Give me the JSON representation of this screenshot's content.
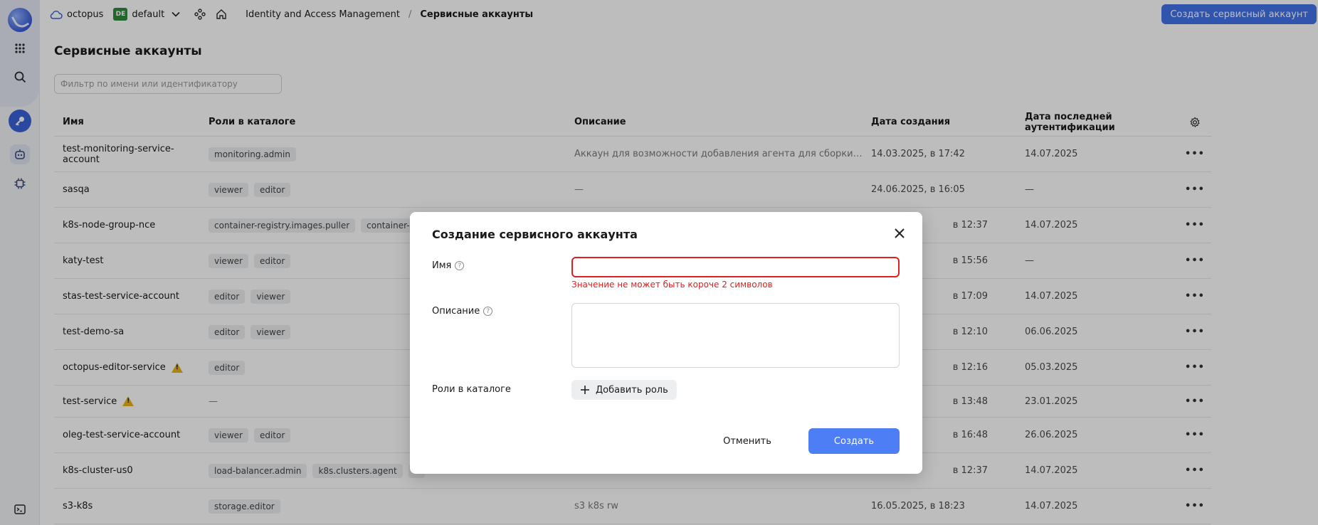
{
  "topbar": {
    "cloud_name": "octopus",
    "folder_badge": "DE",
    "folder_name": "default",
    "service": "Identity and Access Management",
    "separator": "/",
    "current": "Сервисные аккаунты",
    "create_button": "Создать сервисный аккаунт"
  },
  "page": {
    "title": "Сервисные аккаунты",
    "filter_placeholder": "Фильтр по имени или идентификатору"
  },
  "table": {
    "headers": [
      "Имя",
      "Роли в каталоге",
      "Описание",
      "Дата создания",
      "Дата последней аутентификации"
    ],
    "rows": [
      {
        "name": "test-monitoring-service-account",
        "roles": [
          "monitoring.admin"
        ],
        "description": "Аккаун для возможности добавления агента для сборки метрик...",
        "created": "14.03.2025, в 17:42",
        "last_auth": "14.07.2025"
      },
      {
        "name": "sasqa",
        "roles": [
          "viewer",
          "editor"
        ],
        "description": "—",
        "created": "24.06.2025, в 16:05",
        "last_auth": "—"
      },
      {
        "name": "k8s-node-group-nce",
        "roles": [
          "container-registry.images.puller",
          "container-re"
        ],
        "description": "",
        "created": "в 12:37",
        "last_auth": "14.07.2025"
      },
      {
        "name": "katy-test",
        "roles": [
          "viewer",
          "editor"
        ],
        "description": "",
        "created": "в 15:56",
        "last_auth": "—"
      },
      {
        "name": "stas-test-service-account",
        "roles": [
          "editor",
          "viewer"
        ],
        "description": "",
        "created": "в 17:09",
        "last_auth": "14.07.2025"
      },
      {
        "name": "test-demo-sa",
        "roles": [
          "editor",
          "viewer"
        ],
        "description": "",
        "created": "в 12:10",
        "last_auth": "06.06.2025"
      },
      {
        "name": "octopus-editor-service",
        "roles": [
          "editor"
        ],
        "description": "",
        "created": "в 12:16",
        "last_auth": "05.03.2025",
        "warning": true
      },
      {
        "name": "test-service",
        "roles_text": "—",
        "description": "",
        "created": "в 13:48",
        "last_auth": "23.01.2025",
        "warning": true
      },
      {
        "name": "oleg-test-service-account",
        "roles": [
          "viewer",
          "editor"
        ],
        "description": "",
        "created": "в 16:48",
        "last_auth": "26.06.2025"
      },
      {
        "name": "k8s-cluster-us0",
        "roles": [
          "load-balancer.admin",
          "k8s.clusters.agent",
          "v"
        ],
        "description": "",
        "created": "в 12:37",
        "last_auth": "14.07.2025"
      },
      {
        "name": "s3-k8s",
        "roles": [
          "storage.editor"
        ],
        "description": "s3 k8s rw",
        "created": "16.05.2025, в 18:23",
        "last_auth": "14.07.2025"
      }
    ]
  },
  "modal": {
    "title": "Создание сервисного аккаунта",
    "name_label": "Имя",
    "name_value": "",
    "name_error": "Значение не может быть короче 2 символов",
    "description_label": "Описание",
    "description_value": "",
    "roles_label": "Роли в каталоге",
    "add_role_button": "Добавить роль",
    "cancel_button": "Отменить",
    "create_button": "Создать"
  }
}
